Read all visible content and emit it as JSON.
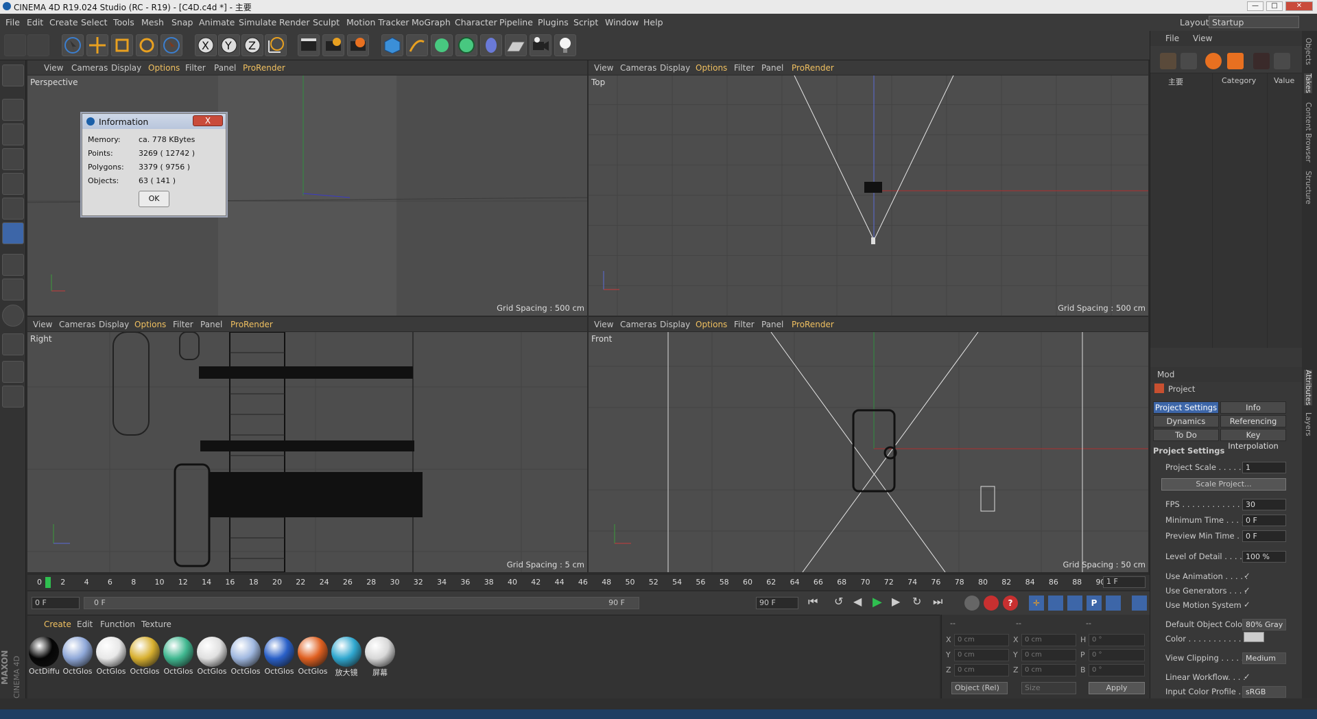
{
  "window": {
    "title": "CINEMA 4D R19.024 Studio (RC - R19) - [C4D.c4d *] - 主要",
    "layout_label": "Layout:",
    "layout_value": "Startup"
  },
  "menubar": [
    "File",
    "Edit",
    "Create",
    "Select",
    "Tools",
    "Mesh",
    "Snap",
    "Animate",
    "Simulate",
    "Render",
    "Sculpt",
    "Motion Tracker",
    "MoGraph",
    "Character",
    "Pipeline",
    "Plugins",
    "Script",
    "Window",
    "Help"
  ],
  "viewport_menu": [
    "View",
    "Cameras",
    "Display",
    "Options",
    "Filter",
    "Panel",
    "ProRender"
  ],
  "viewports": {
    "perspective": {
      "label": "Perspective",
      "grid": ""
    },
    "top": {
      "label": "Top",
      "grid": "Grid Spacing : 500 cm"
    },
    "right": {
      "label": "Right",
      "grid": "Grid Spacing : 5 cm"
    },
    "front": {
      "label": "Front",
      "grid": "Grid Spacing : 50 cm"
    },
    "perspective_grid": "Grid Spacing : 500 cm"
  },
  "info_dialog": {
    "title": "Information",
    "close": "X",
    "rows": [
      {
        "label": "Memory:",
        "value": "ca. 778 KBytes"
      },
      {
        "label": "Points:",
        "value": "3269 ( 12742 )"
      },
      {
        "label": "Polygons:",
        "value": "3379 ( 9756 )"
      },
      {
        "label": "Objects:",
        "value": "63 ( 141 )"
      }
    ],
    "ok": "OK"
  },
  "timeline": {
    "ticks": [
      "0",
      "2",
      "4",
      "6",
      "8",
      "10",
      "12",
      "14",
      "16",
      "18",
      "20",
      "22",
      "24",
      "26",
      "28",
      "30",
      "32",
      "34",
      "36",
      "38",
      "40",
      "42",
      "44",
      "46",
      "48",
      "50",
      "52",
      "54",
      "56",
      "58",
      "60",
      "62",
      "64",
      "66",
      "68",
      "70",
      "72",
      "74",
      "76",
      "78",
      "80",
      "82",
      "84",
      "86",
      "88",
      "90"
    ],
    "current_frame": "1 F",
    "start": "0 F",
    "range_start": "0 F",
    "range_end": "90 F",
    "end": "90 F"
  },
  "materials": {
    "menu": [
      "Create",
      "Edit",
      "Function",
      "Texture"
    ],
    "items": [
      {
        "label": "OctDiffu",
        "color": "#050505"
      },
      {
        "label": "OctGlos",
        "color": "#8fa8d8"
      },
      {
        "label": "OctGlos",
        "color": "#e8e8e8"
      },
      {
        "label": "OctGlos",
        "color": "#d8b030"
      },
      {
        "label": "OctGlos",
        "color": "#40b890"
      },
      {
        "label": "OctGlos",
        "color": "#e0e0e0"
      },
      {
        "label": "OctGlos",
        "color": "#a0b8e0"
      },
      {
        "label": "OctGlos",
        "color": "#2a60c8"
      },
      {
        "label": "OctGlos",
        "color": "#e06020"
      },
      {
        "label": "放大镜",
        "color": "#30a8d0"
      },
      {
        "label": "屏幕",
        "color": "#d8d8d8"
      }
    ]
  },
  "coords": {
    "header": [
      "--",
      "--",
      "--"
    ],
    "rows": [
      {
        "a": "X",
        "av": "0 cm",
        "b": "X",
        "bv": "0 cm",
        "c": "H",
        "cv": "0 °"
      },
      {
        "a": "Y",
        "av": "0 cm",
        "b": "Y",
        "bv": "0 cm",
        "c": "P",
        "cv": "0 °"
      },
      {
        "a": "Z",
        "av": "0 cm",
        "b": "Z",
        "bv": "0 cm",
        "c": "B",
        "cv": "0 °"
      }
    ],
    "mode": "Object (Rel)",
    "size": "Size",
    "apply": "Apply"
  },
  "objects_panel": {
    "menu": [
      "File",
      "View"
    ],
    "tree_item": "主要",
    "columns": [
      "Category",
      "Value"
    ]
  },
  "attributes": {
    "mode": "Mod",
    "header": "Project",
    "tabs": [
      "Project Settings",
      "Info",
      "Dynamics",
      "Referencing",
      "To Do",
      "Key Interpolation"
    ],
    "section": "Project Settings",
    "rows": [
      {
        "label": "Project Scale . . . . . .",
        "value": "1"
      },
      {
        "label": "FPS . . . . . . . . . . . . . .",
        "value": "30"
      },
      {
        "label": "Minimum Time . . . . .",
        "value": "0 F"
      },
      {
        "label": "Preview Min Time . . .",
        "value": "0 F"
      },
      {
        "label": "Level of Detail . . . . .",
        "value": "100 %"
      },
      {
        "label": "Use Animation . . . . .",
        "value": "✓"
      },
      {
        "label": "Use Generators . . . .",
        "value": "✓"
      },
      {
        "label": "Use Motion System",
        "value": "✓"
      },
      {
        "label": "Default Object Color",
        "value": "80% Gray"
      },
      {
        "label": "Color . . . . . . . . . . .",
        "value": ""
      },
      {
        "label": "View Clipping . . . . .",
        "value": "Medium"
      },
      {
        "label": "Linear Workflow. . . .",
        "value": "✓"
      },
      {
        "label": "Input Color Profile . .",
        "value": "sRGB"
      }
    ],
    "scale_button": "Scale Project..."
  },
  "side_tabs": [
    "Objects",
    "Takes",
    "Content Browser",
    "Structure",
    "Attributes",
    "Layers"
  ],
  "brand": [
    "MAXON",
    "CINEMA 4D"
  ]
}
